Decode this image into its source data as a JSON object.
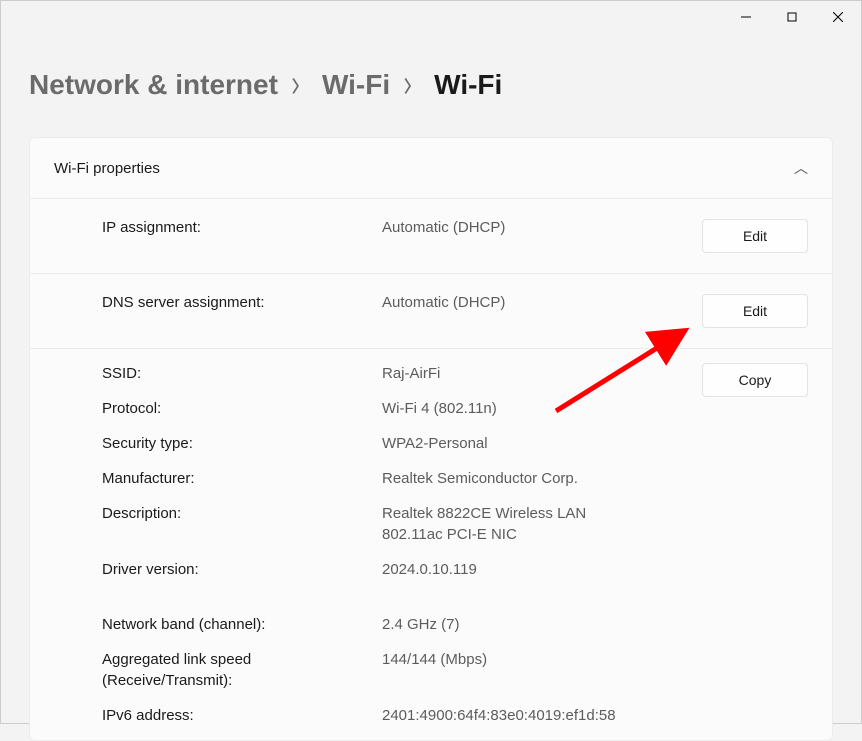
{
  "breadcrumb": {
    "level1": "Network & internet",
    "level2": "Wi-Fi",
    "level3": "Wi-Fi"
  },
  "panel": {
    "title": "Wi-Fi properties"
  },
  "ip_assignment": {
    "label": "IP assignment:",
    "value": "Automatic (DHCP)",
    "button": "Edit"
  },
  "dns_assignment": {
    "label": "DNS server assignment:",
    "value": "Automatic (DHCP)",
    "button": "Edit"
  },
  "details": {
    "copy_button": "Copy",
    "ssid": {
      "label": "SSID:",
      "value": "Raj-AirFi"
    },
    "protocol": {
      "label": "Protocol:",
      "value": "Wi-Fi 4 (802.11n)"
    },
    "security": {
      "label": "Security type:",
      "value": "WPA2-Personal"
    },
    "manufacturer": {
      "label": "Manufacturer:",
      "value": "Realtek Semiconductor Corp."
    },
    "description": {
      "label": "Description:",
      "value": "Realtek 8822CE Wireless LAN 802.11ac PCI-E NIC"
    },
    "driver": {
      "label": "Driver version:",
      "value": "2024.0.10.119"
    },
    "band": {
      "label": "Network band (channel):",
      "value": "2.4 GHz (7)"
    },
    "link_speed": {
      "label": "Aggregated link speed (Receive/Transmit):",
      "value": "144/144 (Mbps)"
    },
    "ipv6": {
      "label": "IPv6 address:",
      "value": "2401:4900:64f4:83e0:4019:ef1d:58"
    }
  }
}
